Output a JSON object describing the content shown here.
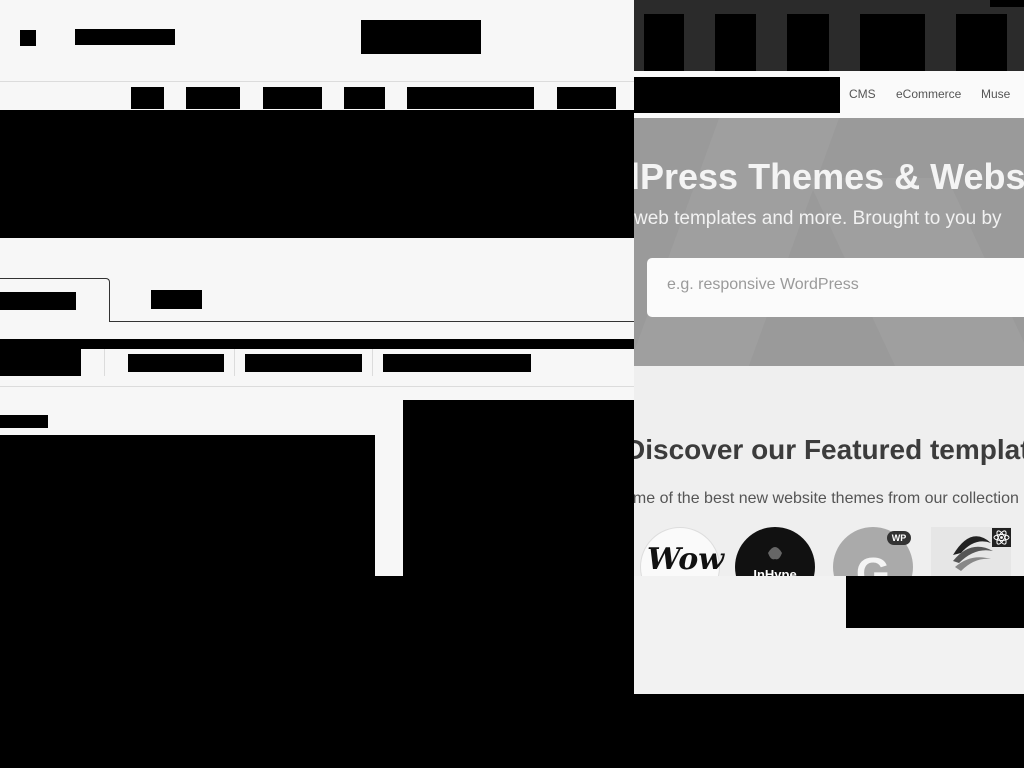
{
  "right_window": {
    "nav": {
      "items": [
        "CMS",
        "eCommerce",
        "Muse"
      ]
    },
    "hero": {
      "title": "dPress Themes & Webs",
      "subtitle": "web templates and more. Brought to you by",
      "search_placeholder": "e.g. responsive WordPress"
    },
    "featured": {
      "title": "Discover our Featured templat",
      "subtitle": "ome of the best new website themes from our collection",
      "thumbnails": [
        {
          "name": "Wow",
          "label": "Wow"
        },
        {
          "name": "InHype",
          "label": "InHype"
        },
        {
          "name": "G",
          "label": "G",
          "badge": "WP"
        },
        {
          "name": "React theme",
          "label": ""
        }
      ]
    }
  },
  "colors": {
    "hero_bg": "#9a9a9a",
    "top_bar": "#2b2b2b",
    "page_bg": "#efefef",
    "left_bg": "#f7f7f7"
  },
  "icons": [
    "react-atom-icon"
  ]
}
